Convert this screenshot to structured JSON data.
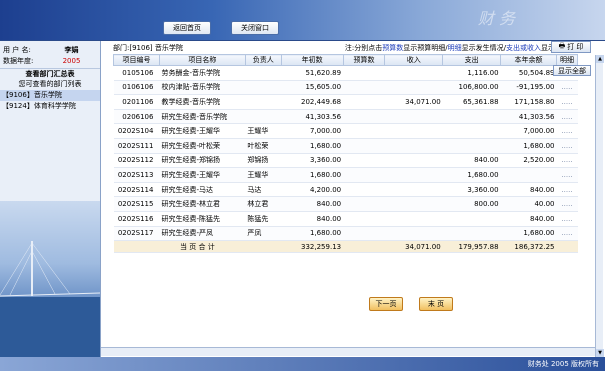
{
  "toolbar": {
    "home_label": "返回首页",
    "close_label": "关闭窗口",
    "deco_text": "财  务"
  },
  "sidebar": {
    "user_key": "用 户 名:",
    "user_value": "李娟",
    "year_key": "数据年度:",
    "year_value": "2005",
    "summary_title": "查看部门汇总表",
    "list_title": "您可查看的部门列表",
    "departments": [
      {
        "label": "【9106】音乐学院"
      },
      {
        "label": "【9124】体育科学学院"
      }
    ]
  },
  "header": {
    "dept_label": "部门:[9106] 音乐学院",
    "note_prefix": "注:分别点击",
    "note_budget": "预算数",
    "note_mid1": "显示预算明细/",
    "note_detail": "明细",
    "note_mid2": "显示发生情况/",
    "note_spend": "支出或收入",
    "note_suffix": "显示科目分析",
    "print_label": "打 印",
    "show_all_label": "显示全部"
  },
  "table": {
    "columns": [
      "项目编号",
      "项目名称",
      "负责人",
      "年初数",
      "预算数",
      "收入",
      "支出",
      "本年余额",
      "明细"
    ],
    "rows": [
      [
        "0105106",
        "劳务酬金-音乐学院",
        "",
        "51,620.89",
        "",
        "",
        "1,116.00",
        "50,504.89",
        "....."
      ],
      [
        "0106106",
        "校内津贴-音乐学院",
        "",
        "15,605.00",
        "",
        "",
        "106,800.00",
        "-91,195.00",
        "....."
      ],
      [
        "0201106",
        "教学经费-音乐学院",
        "",
        "202,449.68",
        "",
        "34,071.00",
        "65,361.88",
        "171,158.80",
        "....."
      ],
      [
        "0206106",
        "研究生经费-音乐学院",
        "",
        "41,303.56",
        "",
        "",
        "",
        "41,303.56",
        "....."
      ],
      [
        "0202S104",
        "研究生经费-王耀华",
        "王耀华",
        "7,000.00",
        "",
        "",
        "",
        "7,000.00",
        "....."
      ],
      [
        "0202S111",
        "研究生经费-叶松荣",
        "叶松荣",
        "1,680.00",
        "",
        "",
        "",
        "1,680.00",
        "....."
      ],
      [
        "0202S112",
        "研究生经费-郑锦扬",
        "郑锦扬",
        "3,360.00",
        "",
        "",
        "840.00",
        "2,520.00",
        "....."
      ],
      [
        "0202S113",
        "研究生经费-王耀华",
        "王耀华",
        "1,680.00",
        "",
        "",
        "1,680.00",
        "",
        "....."
      ],
      [
        "0202S114",
        "研究生经费-马达",
        "马达",
        "4,200.00",
        "",
        "",
        "3,360.00",
        "840.00",
        "....."
      ],
      [
        "0202S115",
        "研究生经费-林立君",
        "林立君",
        "840.00",
        "",
        "",
        "800.00",
        "40.00",
        "....."
      ],
      [
        "0202S116",
        "研究生经费-陈猛先",
        "陈猛先",
        "840.00",
        "",
        "",
        "",
        "840.00",
        "....."
      ],
      [
        "0202S117",
        "研究生经费-严凤",
        "严凤",
        "1,680.00",
        "",
        "",
        "",
        "1,680.00",
        "....."
      ]
    ],
    "total": [
      "当 页 合 计",
      "332,259.13",
      "",
      "34,071.00",
      "179,957.88",
      "186,372.25"
    ]
  },
  "pager": {
    "next_label": "下一页",
    "last_label": "末 页"
  },
  "footer": {
    "text": "财务处 2005 版权所有"
  },
  "colors": {
    "accent": "#2a4f9a",
    "total_row": "#f8efd8",
    "year_value": "#cc0000"
  }
}
